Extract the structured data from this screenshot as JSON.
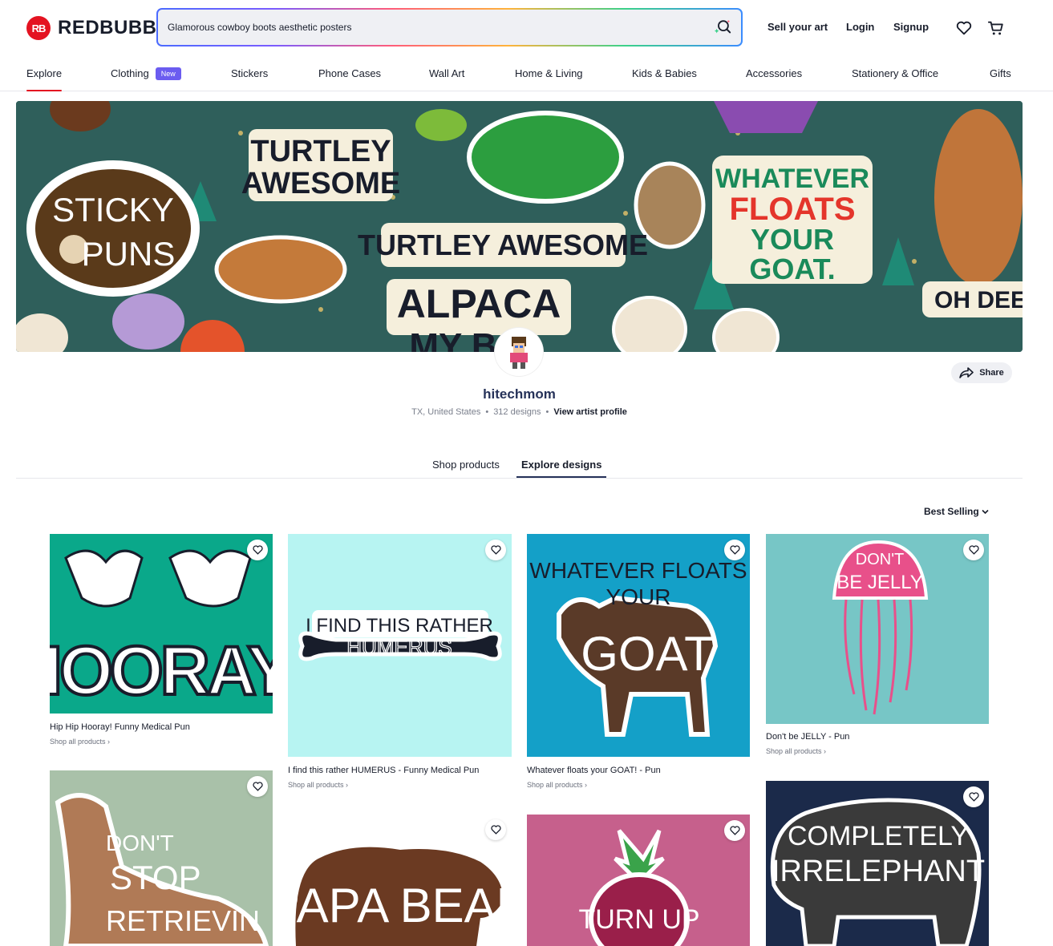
{
  "brand": {
    "name": "REDBUBBLE",
    "mark": "RB",
    "color": "#e41321"
  },
  "search": {
    "value": "Glamorous cowboy boots aesthetic posters"
  },
  "header_links": [
    "Sell your art",
    "Login",
    "Signup"
  ],
  "categories": [
    {
      "label": "Explore"
    },
    {
      "label": "Clothing",
      "badge": "New"
    },
    {
      "label": "Stickers"
    },
    {
      "label": "Phone Cases"
    },
    {
      "label": "Wall Art"
    },
    {
      "label": "Home & Living"
    },
    {
      "label": "Kids & Babies"
    },
    {
      "label": "Accessories"
    },
    {
      "label": "Stationery & Office"
    },
    {
      "label": "Gifts"
    }
  ],
  "banner": {
    "logo_line1": "STICKY",
    "logo_line2": "PUNS",
    "texts": [
      "TURTLEY",
      "AWESOME",
      "TURTLEY AWESOME",
      "ALPACA",
      "MY B",
      "WHATEVER",
      "FLOATS",
      "YOUR",
      "GOAT.",
      "OH DEER"
    ]
  },
  "profile": {
    "username": "hitechmom",
    "location": "TX, United States",
    "designs": "312 designs",
    "view_link": "View artist profile",
    "share": "Share"
  },
  "tabs": [
    "Shop products",
    "Explore designs"
  ],
  "sort": "Best Selling",
  "shop_all": "Shop all products",
  "cards": [
    {
      "title": "Hip Hip Hooray! Funny Medical Pun",
      "art": [
        "HOORAY!"
      ],
      "bg": "#0aa88a"
    },
    {
      "title": "I find this rather HUMERUS - Funny Medical Pun",
      "art": [
        "I FIND THIS RATHER",
        "HUMERUS"
      ],
      "bg": "#b7f4f2"
    },
    {
      "title": "Whatever floats your GOAT! - Pun",
      "art": [
        "WHATEVER FLOATS",
        "YOUR",
        "GOAT"
      ],
      "bg": "#14a0c8"
    },
    {
      "title": "Don't be JELLY - Pun",
      "art": [
        "DON'T",
        "BE JELLY"
      ],
      "bg": "#77c6c6"
    },
    {
      "title": "",
      "art": [
        "DON'T",
        "STOP",
        "RETRIEVIN"
      ],
      "bg": "#a9c1a9"
    },
    {
      "title": "",
      "art": [
        "PAPA BEAR"
      ],
      "bg": "#ffffff"
    },
    {
      "title": "",
      "art": [
        "TURN UP"
      ],
      "bg": "#c6608c"
    },
    {
      "title": "",
      "art": [
        "COMPLETELY",
        "IRRELEPHANT"
      ],
      "bg": "#1b2a4a"
    }
  ]
}
